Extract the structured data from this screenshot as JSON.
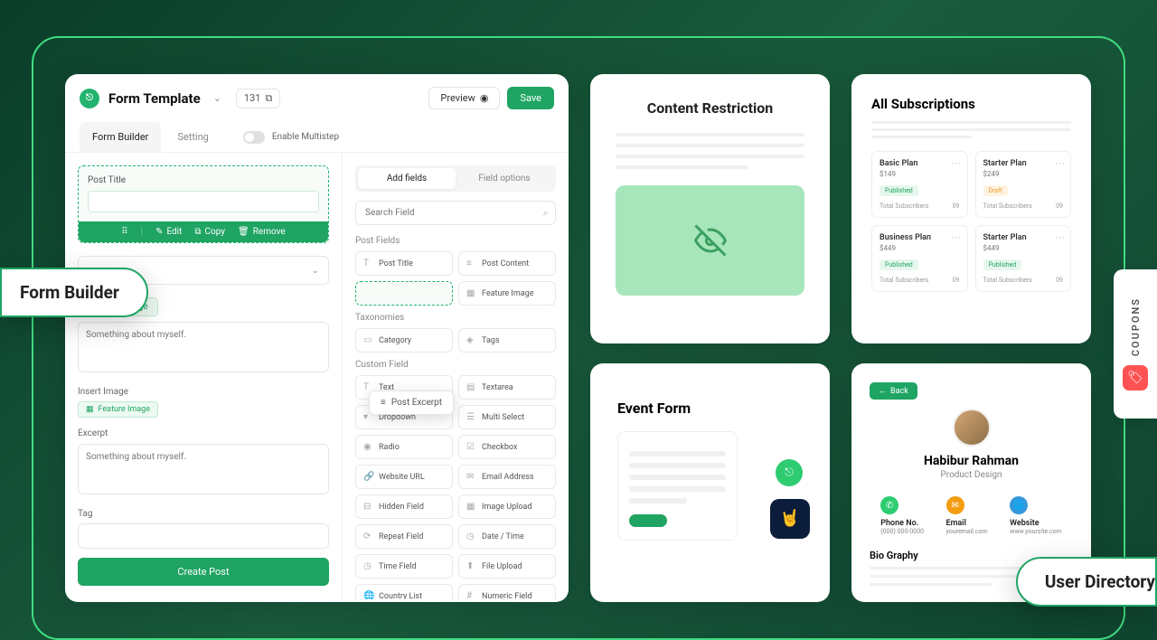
{
  "form_builder": {
    "title": "Form Template",
    "count": "131",
    "preview": "Preview",
    "save": "Save",
    "tabs": {
      "form_builder": "Form Builder",
      "setting": "Setting"
    },
    "enable_multistep": "Enable Multistep",
    "post_title_label": "Post Title",
    "actions": {
      "edit": "Edit",
      "copy": "Copy",
      "remove": "Remove"
    },
    "insert_image_btn": "Insert Image",
    "post_excerpt_float": "Post Excerpt",
    "about_text": "Something about myself.",
    "insert_image_label": "Insert Image",
    "feature_image_chip": "Feature Image",
    "excerpt_label": "Excerpt",
    "excerpt_text": "Something about myself.",
    "tag_label": "Tag",
    "create_post": "Create Post"
  },
  "right_panel": {
    "tabs": {
      "add": "Add fields",
      "options": "Field options"
    },
    "search_placeholder": "Search Field",
    "groups": {
      "post_fields": "Post Fields",
      "taxonomies": "Taxonomies",
      "custom_field": "Custom Field"
    },
    "fields": {
      "post_title": "Post Title",
      "post_content": "Post Content",
      "feature_image": "Feature Image",
      "category": "Category",
      "tags": "Tags",
      "text": "Text",
      "textarea": "Textarea",
      "dropdown": "Dropdown",
      "multi_select": "Multi Select",
      "radio": "Radio",
      "checkbox": "Checkbox",
      "website_url": "Website URL",
      "email_address": "Email Address",
      "hidden_field": "Hidden Field",
      "image_upload": "Image Upload",
      "repeat_field": "Repeat Field",
      "date_time": "Date / Time",
      "time_field": "Time Field",
      "file_upload": "File Upload",
      "country_list": "Country List",
      "numeric_field": "Numeric Field"
    }
  },
  "content_restriction": {
    "title": "Content Restriction"
  },
  "subscriptions": {
    "title": "All Subscriptions",
    "plans": [
      {
        "name": "Basic Plan",
        "price": "$149",
        "status": "Published",
        "status_type": "published",
        "sub_label": "Total Subscribers",
        "count": "09"
      },
      {
        "name": "Starter Plan",
        "price": "$249",
        "status": "Draft",
        "status_type": "draft",
        "sub_label": "Total Subscribers",
        "count": "09"
      },
      {
        "name": "Business Plan",
        "price": "$449",
        "status": "Published",
        "status_type": "published",
        "sub_label": "Total Subscribers",
        "count": "09"
      },
      {
        "name": "Starter Plan",
        "price": "$449",
        "status": "Published",
        "status_type": "published",
        "sub_label": "Total Subscribers",
        "count": "09"
      }
    ]
  },
  "event_form": {
    "title": "Event Form"
  },
  "user_directory": {
    "back": "Back",
    "name": "Habibur Rahman",
    "role": "Product Design",
    "phone_label": "Phone No.",
    "phone_value": "(000) 000-0000",
    "email_label": "Email",
    "email_value": "youremail.com",
    "website_label": "Website",
    "website_value": "www.yoursite.com",
    "bio_label": "Bio Graphy"
  },
  "floating": {
    "form_builder": "Form Builder",
    "user_directory": "User Directory",
    "coupons": "COUPONS"
  }
}
